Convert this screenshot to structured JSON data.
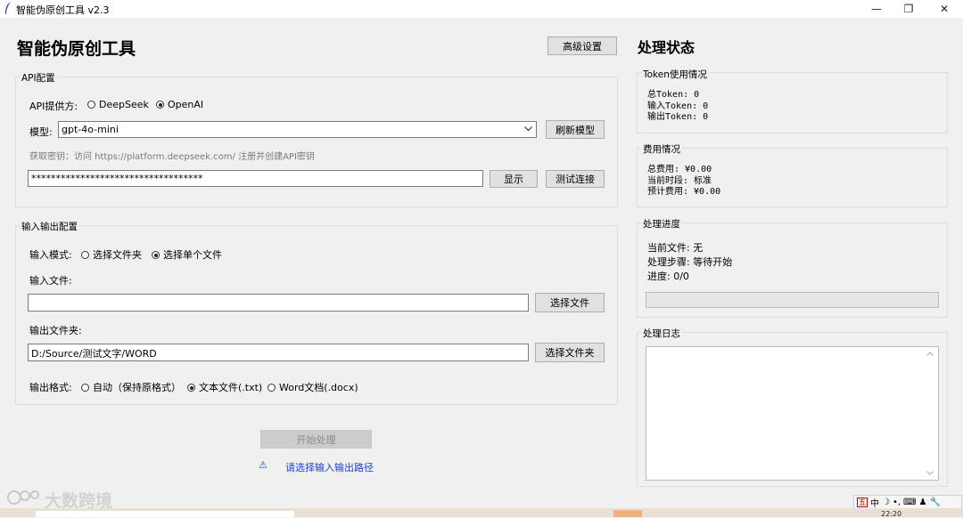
{
  "window": {
    "title": "智能伪原创工具 v2.3",
    "minimize": "—",
    "maximize": "❐",
    "close": "✕"
  },
  "main": {
    "title": "智能伪原创工具",
    "advanced_button": "高级设置",
    "api_group": {
      "legend": "API配置",
      "provider_label": "API提供方:",
      "providers": [
        "DeepSeek",
        "OpenAI"
      ],
      "selected_provider": "OpenAI",
      "model_label": "模型:",
      "model_value": "gpt-4o-mini",
      "refresh_button": "刷新模型",
      "key_hint": "获取密钥：访问 https://platform.deepseek.com/ 注册并创建API密钥",
      "api_key_value": "***********************************",
      "show_button": "显示",
      "test_button": "测试连接"
    },
    "io_group": {
      "legend": "输入输出配置",
      "input_mode_label": "输入模式:",
      "modes": [
        "选择文件夹",
        "选择单个文件"
      ],
      "selected_mode": "选择单个文件",
      "input_file_label": "输入文件:",
      "input_file_value": "",
      "select_file_button": "选择文件",
      "output_folder_label": "输出文件夹:",
      "output_folder_value": "D:/Source/测试文字/WORD",
      "select_folder_button": "选择文件夹",
      "format_label": "输出格式:",
      "formats": [
        "自动（保持原格式）",
        "文本文件(.txt)",
        "Word文档(.docx)"
      ],
      "selected_format": "文本文件(.txt)"
    },
    "start_button": "开始处理",
    "warning_icon": "⚠",
    "warning_text": "请选择输入输出路径"
  },
  "status": {
    "title": "处理状态",
    "token": {
      "legend": "Token使用情况",
      "lines": [
        "总Token: 0",
        "输入Token: 0",
        "输出Token: 0"
      ]
    },
    "cost": {
      "legend": "费用情况",
      "lines": [
        "总费用: ¥0.00",
        "当前时段: 标准",
        "预计费用: ¥0.00"
      ]
    },
    "progress": {
      "legend": "处理进度",
      "lines": [
        "当前文件: 无",
        "处理步骤: 等待开始",
        "进度: 0/0"
      ],
      "fraction": 0
    },
    "log": {
      "legend": "处理日志",
      "content": ""
    }
  },
  "overlay": {
    "watermark": "大数跨境",
    "ime_items": [
      "五",
      "中",
      "☽",
      "•,",
      "⌨",
      "♟",
      "🔧"
    ]
  },
  "taskbar": {
    "clock": "22:20"
  }
}
